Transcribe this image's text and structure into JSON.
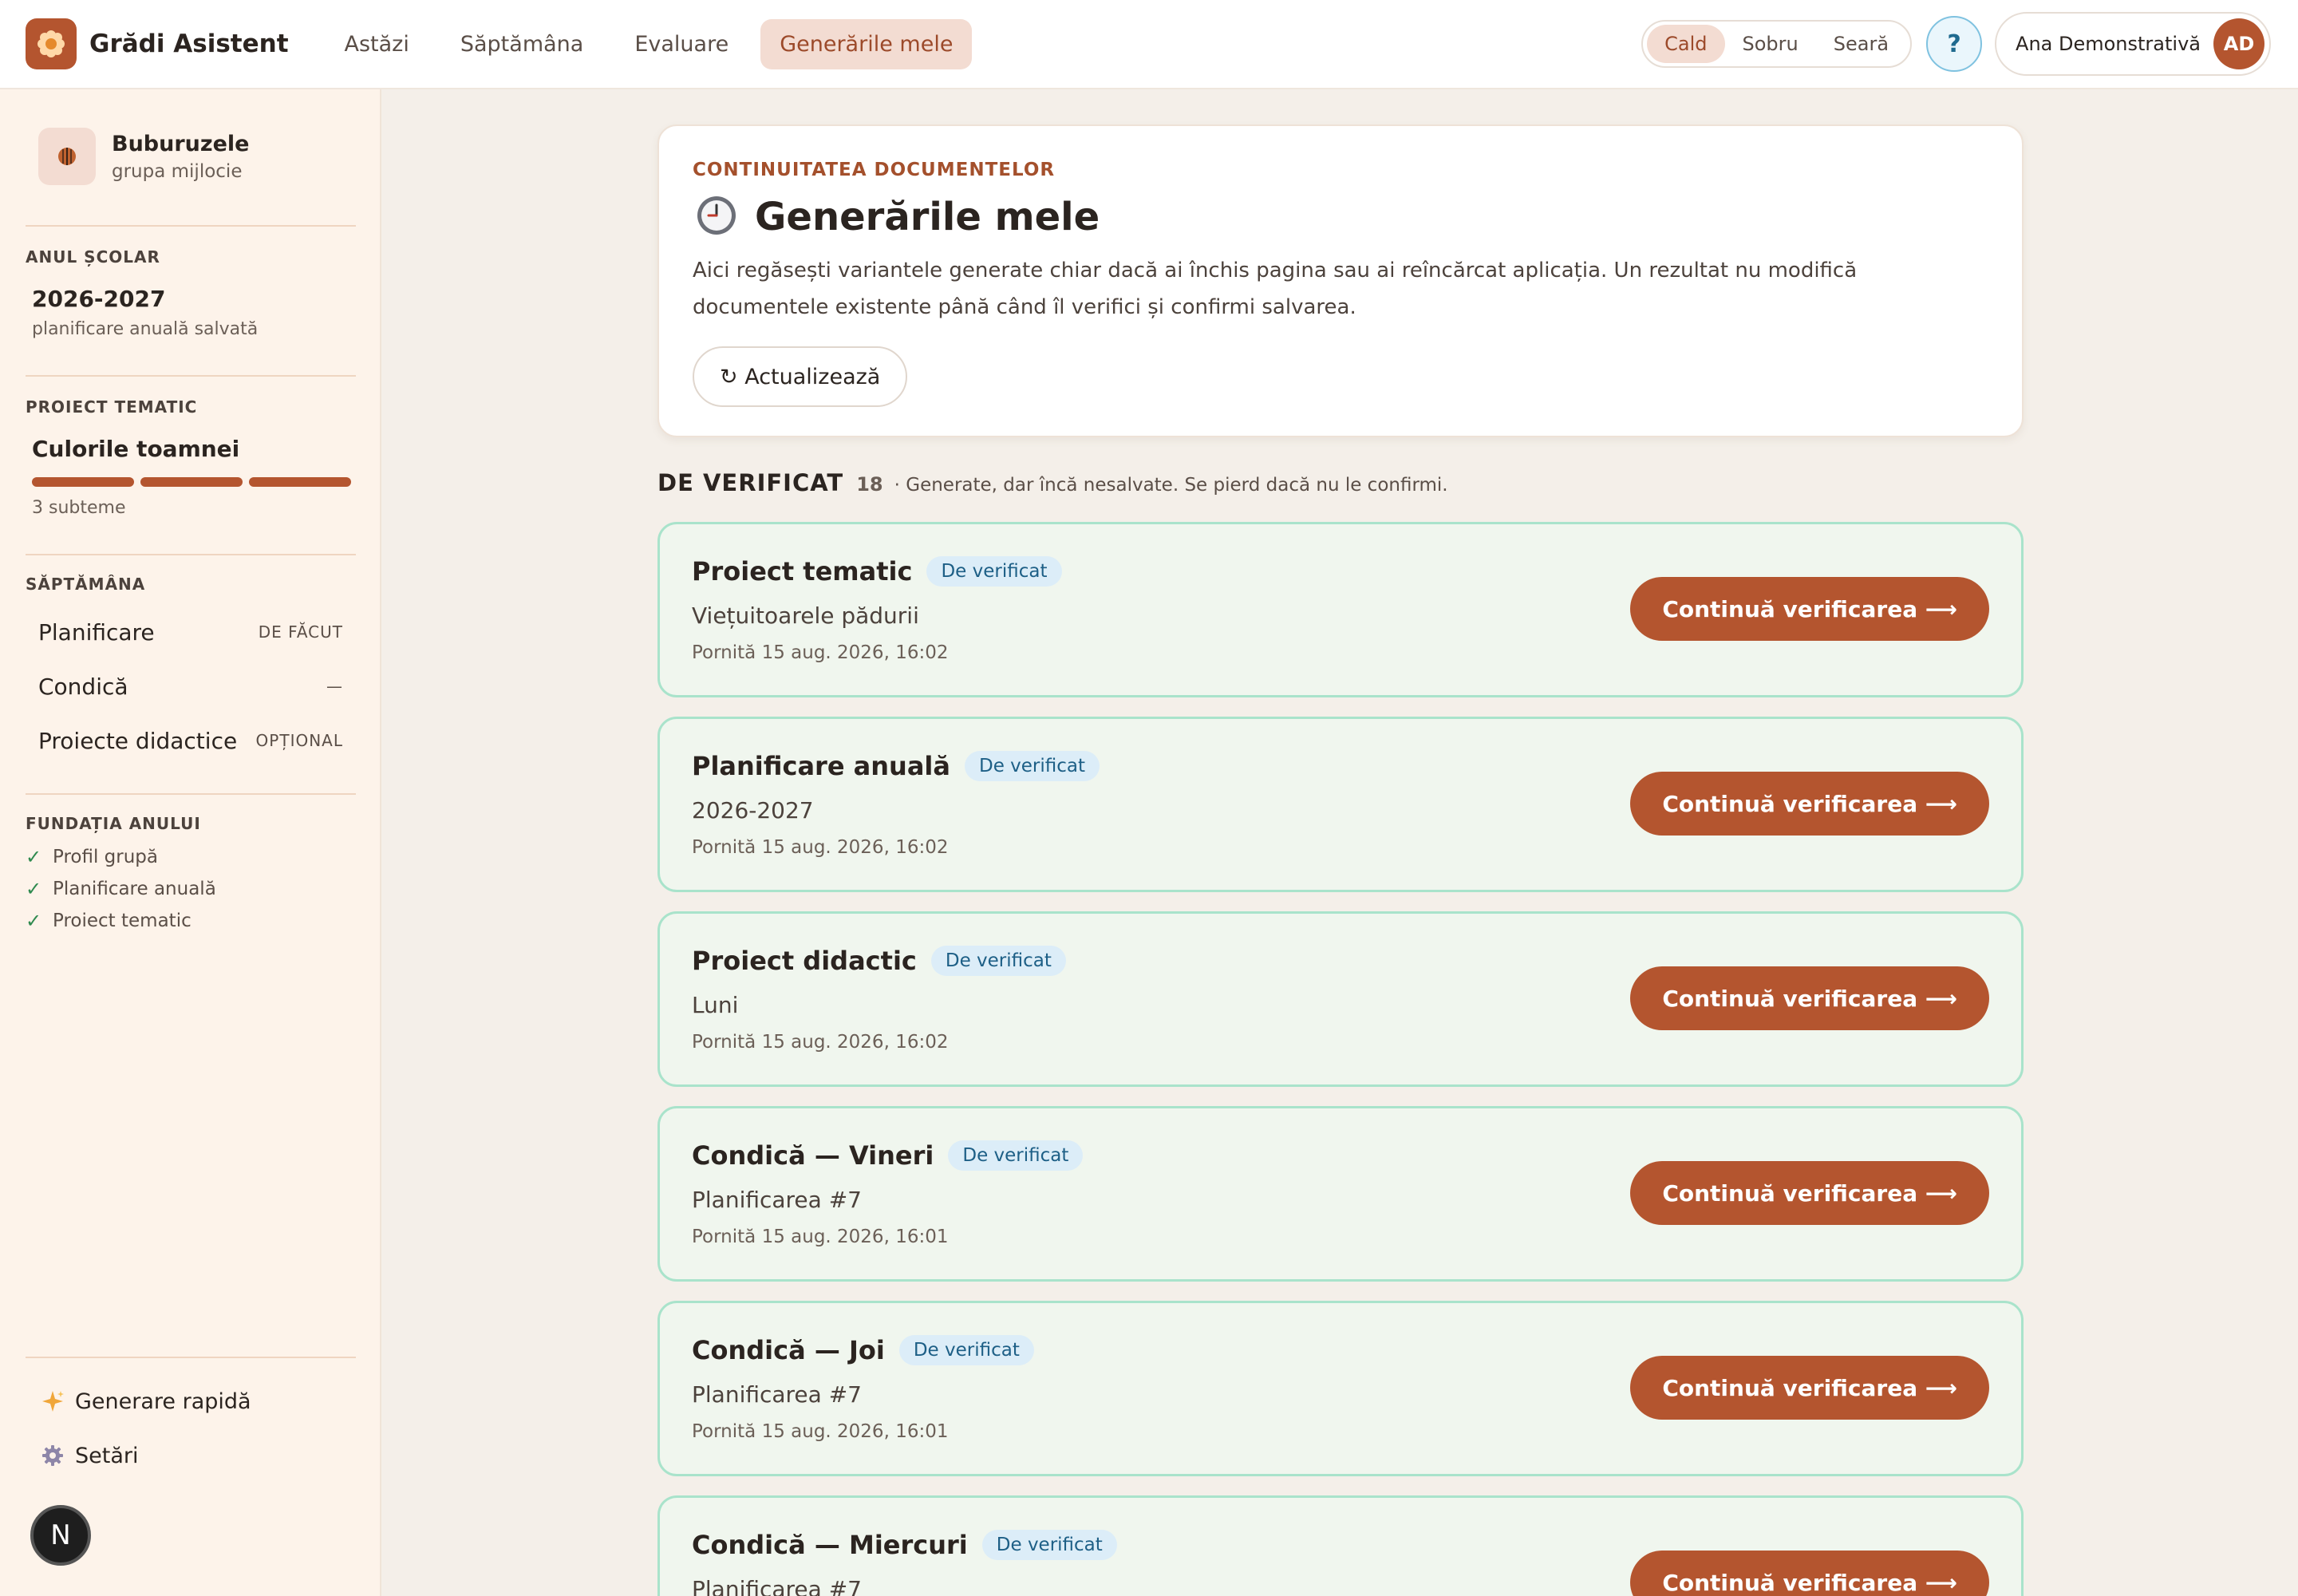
{
  "brand": {
    "name": "Grădi Asistent",
    "logo_icon": "flower-icon"
  },
  "nav": {
    "items": [
      {
        "label": "Astăzi",
        "active": false
      },
      {
        "label": "Săptămâna",
        "active": false
      },
      {
        "label": "Evaluare",
        "active": false
      },
      {
        "label": "Generările mele",
        "active": true
      }
    ]
  },
  "theme": {
    "options": [
      "Cald",
      "Sobru",
      "Seară"
    ],
    "selected": "Cald"
  },
  "help": {
    "label": "?"
  },
  "user": {
    "name": "Ana Demonstrativă",
    "initials": "AD"
  },
  "sidebar": {
    "group": {
      "name": "Buburuzele",
      "subtitle": "grupa mijlocie",
      "icon": "ladybug-icon"
    },
    "school_year": {
      "label": "ANUL ȘCOLAR",
      "value": "2026-2027",
      "note": "planificare anuală salvată"
    },
    "project": {
      "label": "PROIECT TEMATIC",
      "name": "Culorile toamnei",
      "note": "3 subteme",
      "subthemes_completed": 3
    },
    "week": {
      "label": "SĂPTĂMÂNA",
      "items": [
        {
          "name": "Planificare",
          "status": "DE FĂCUT"
        },
        {
          "name": "Condică",
          "status": "—"
        },
        {
          "name": "Proiecte didactice",
          "status": "OPȚIONAL"
        }
      ]
    },
    "foundation": {
      "label": "FUNDAȚIA ANULUI",
      "mark": "✓",
      "items": [
        "Profil grupă",
        "Planificare anuală",
        "Proiect tematic"
      ]
    },
    "actions": {
      "quick": {
        "label": "Generare rapidă",
        "icon": "sparkles-icon"
      },
      "settings": {
        "label": "Setări",
        "icon": "gear-icon"
      }
    },
    "dev_badge": "N"
  },
  "hero": {
    "kicker": "CONTINUITATEA DOCUMENTELOR",
    "title": "Generările mele",
    "title_icon": "clock-icon",
    "description": "Aici regăsești variantele generate chiar dacă ai închis pagina sau ai reîncărcat aplicația. Un rezultat nu modifică documentele existente până când îl verifici și confirmi salvarea.",
    "refresh_label": "↻ Actualizează"
  },
  "section": {
    "title": "DE VERIFICAT",
    "count": "18",
    "note": "· Generate, dar încă nesalvate. Se pierd dacă nu le confirmi."
  },
  "cards": [
    {
      "title": "Proiect tematic",
      "badge": "De verificat",
      "subtitle": "Viețuitoarele pădurii",
      "meta": "Pornită 15 aug. 2026, 16:02",
      "action": "Continuă verificarea ⟶"
    },
    {
      "title": "Planificare anuală",
      "badge": "De verificat",
      "subtitle": "2026-2027",
      "meta": "Pornită 15 aug. 2026, 16:02",
      "action": "Continuă verificarea ⟶"
    },
    {
      "title": "Proiect didactic",
      "badge": "De verificat",
      "subtitle": "Luni",
      "meta": "Pornită 15 aug. 2026, 16:02",
      "action": "Continuă verificarea ⟶"
    },
    {
      "title": "Condică — Vineri",
      "badge": "De verificat",
      "subtitle": "Planificarea #7",
      "meta": "Pornită 15 aug. 2026, 16:01",
      "action": "Continuă verificarea ⟶"
    },
    {
      "title": "Condică — Joi",
      "badge": "De verificat",
      "subtitle": "Planificarea #7",
      "meta": "Pornită 15 aug. 2026, 16:01",
      "action": "Continuă verificarea ⟶"
    },
    {
      "title": "Condică — Miercuri",
      "badge": "De verificat",
      "subtitle": "Planificarea #7",
      "meta": "",
      "action": "Continuă verificarea ⟶"
    }
  ],
  "colors": {
    "accent": "#b4552f",
    "card_border": "#a9e3cb",
    "card_bg": "#f0f6ee",
    "badge_text": "#1d5f86"
  }
}
